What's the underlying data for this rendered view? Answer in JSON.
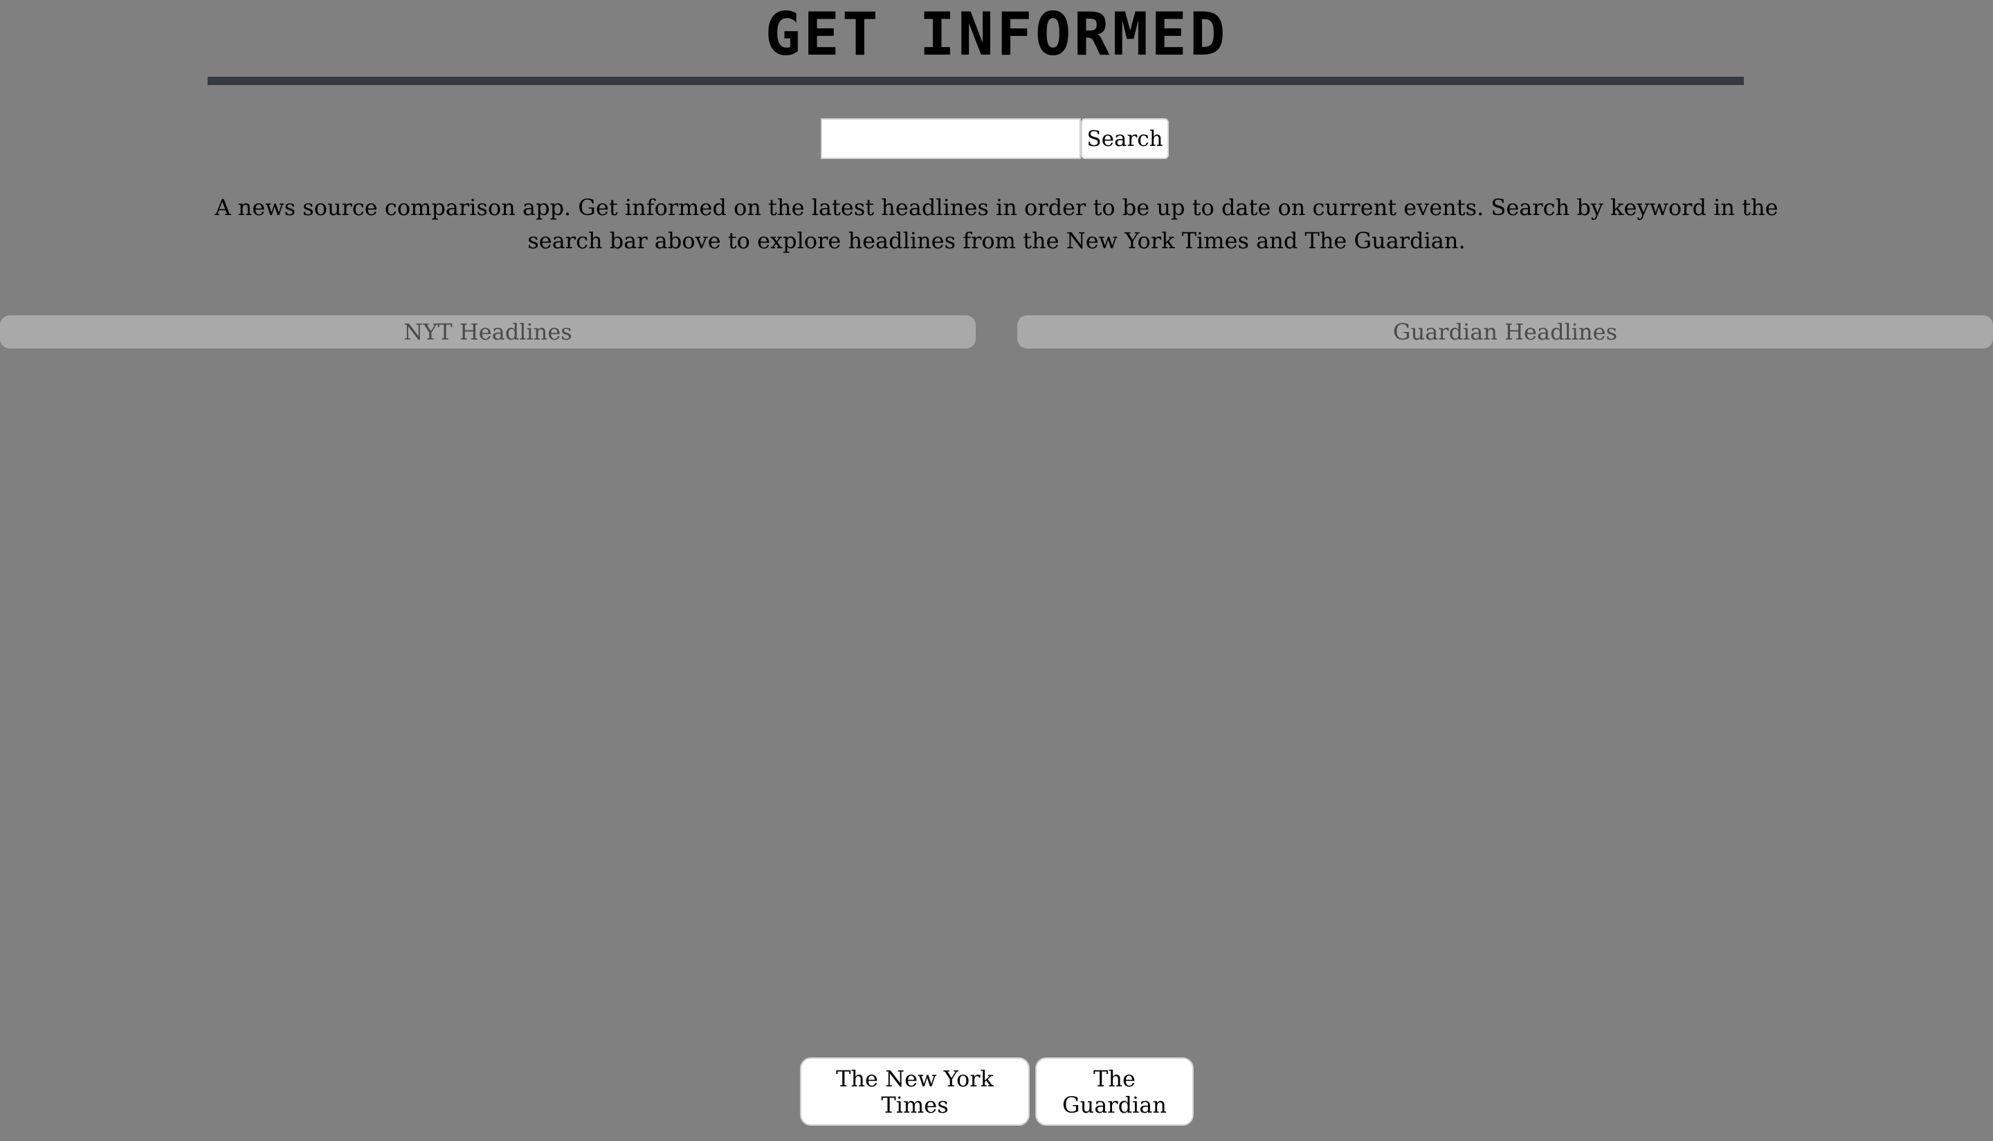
{
  "header": {
    "title": "Get Informed"
  },
  "search": {
    "value": "",
    "placeholder": "",
    "button_label": "Search"
  },
  "description": "A news source comparison app. Get informed on the latest headlines in order to be up to date on current events. Search by keyword in the search bar above to explore headlines from the New York Times and The Guardian.",
  "columns": {
    "nyt_title": "NYT Headlines",
    "guardian_title": "Guardian Headlines"
  },
  "footer": {
    "nyt_button_label": "The New York Times",
    "guardian_button_label": "The Guardian"
  },
  "colors": {
    "background": "#808080",
    "rule": "#343a40",
    "column_header": "#a9a9a9"
  }
}
